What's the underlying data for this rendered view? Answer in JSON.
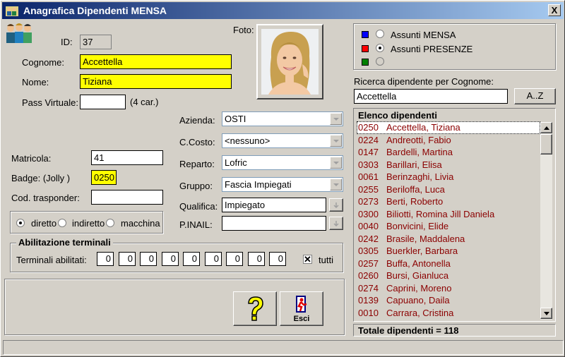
{
  "window": {
    "title": "Anagrafica Dipendenti MENSA",
    "close": "X"
  },
  "form": {
    "id_label": "ID:",
    "id_value": "37",
    "foto_label": "Foto:",
    "cognome_label": "Cognome:",
    "cognome": "Accettella",
    "nome_label": "Nome:",
    "nome": "Tiziana",
    "pass_label": "Pass Virtuale:",
    "pass_value": "",
    "pass_hint": "(4 car.)",
    "matricola_label": "Matricola:",
    "matricola": "41",
    "badge_label": "Badge:  (Jolly )",
    "badge": "0250",
    "trasp_label": "Cod. trasponder:",
    "trasp": "",
    "radio_diretto": "diretto",
    "radio_indiretto": "indiretto",
    "radio_macchina": "macchina",
    "azienda_label": "Azienda:",
    "azienda": "OSTI",
    "ccosto_label": "C.Costo:",
    "ccosto": "<nessuno>",
    "reparto_label": "Reparto:",
    "reparto": "Lofric",
    "gruppo_label": "Gruppo:",
    "gruppo": "Fascia Impiegati",
    "qualifica_label": "Qualifica:",
    "qualifica": "Impiegato",
    "pinail_label": "P.INAIL:",
    "pinail": ""
  },
  "terminali": {
    "title": "Abilitazione terminali",
    "label": "Terminali abilitati:",
    "values": [
      "0",
      "0",
      "0",
      "0",
      "0",
      "0",
      "0",
      "0",
      "0"
    ],
    "tutti_label": "tutti",
    "tutti_checked": true
  },
  "filter": {
    "assunti_mensa": "Assunti MENSA",
    "assunti_presenze": "Assunti PRESENZE",
    "selected": "presenze",
    "mensa_color": "#0000ff",
    "presenze_color": "#ff0000",
    "third_color": "#008000"
  },
  "search": {
    "label": "Ricerca dipendente per Cognome:",
    "value": "Accettella",
    "az_button": "A..Z"
  },
  "list": {
    "title": "Elenco dipendenti",
    "items": [
      {
        "code": "0250",
        "name": "Accettella, Tiziana"
      },
      {
        "code": "0224",
        "name": "Andreotti, Fabio"
      },
      {
        "code": "0147",
        "name": "Bardelli, Martina"
      },
      {
        "code": "0303",
        "name": "Barillari, Elisa"
      },
      {
        "code": "0061",
        "name": "Berinzaghi, Livia"
      },
      {
        "code": "0255",
        "name": "Beriloffa, Luca"
      },
      {
        "code": "0273",
        "name": "Berti, Roberto"
      },
      {
        "code": "0300",
        "name": "Biliotti, Romina Jill Daniela"
      },
      {
        "code": "0040",
        "name": "Bonvicini, Elide"
      },
      {
        "code": "0242",
        "name": "Brasile, Maddalena"
      },
      {
        "code": "0305",
        "name": "Buerkler, Barbara"
      },
      {
        "code": "0257",
        "name": "Buffa, Antonella"
      },
      {
        "code": "0260",
        "name": "Bursi, Gianluca"
      },
      {
        "code": "0274",
        "name": "Caprini, Moreno"
      },
      {
        "code": "0139",
        "name": "Capuano, Daila"
      },
      {
        "code": "0010",
        "name": "Carrara, Cristina"
      }
    ],
    "total": "Totale dipendenti = 118"
  },
  "buttons": {
    "esci": "Esci"
  }
}
